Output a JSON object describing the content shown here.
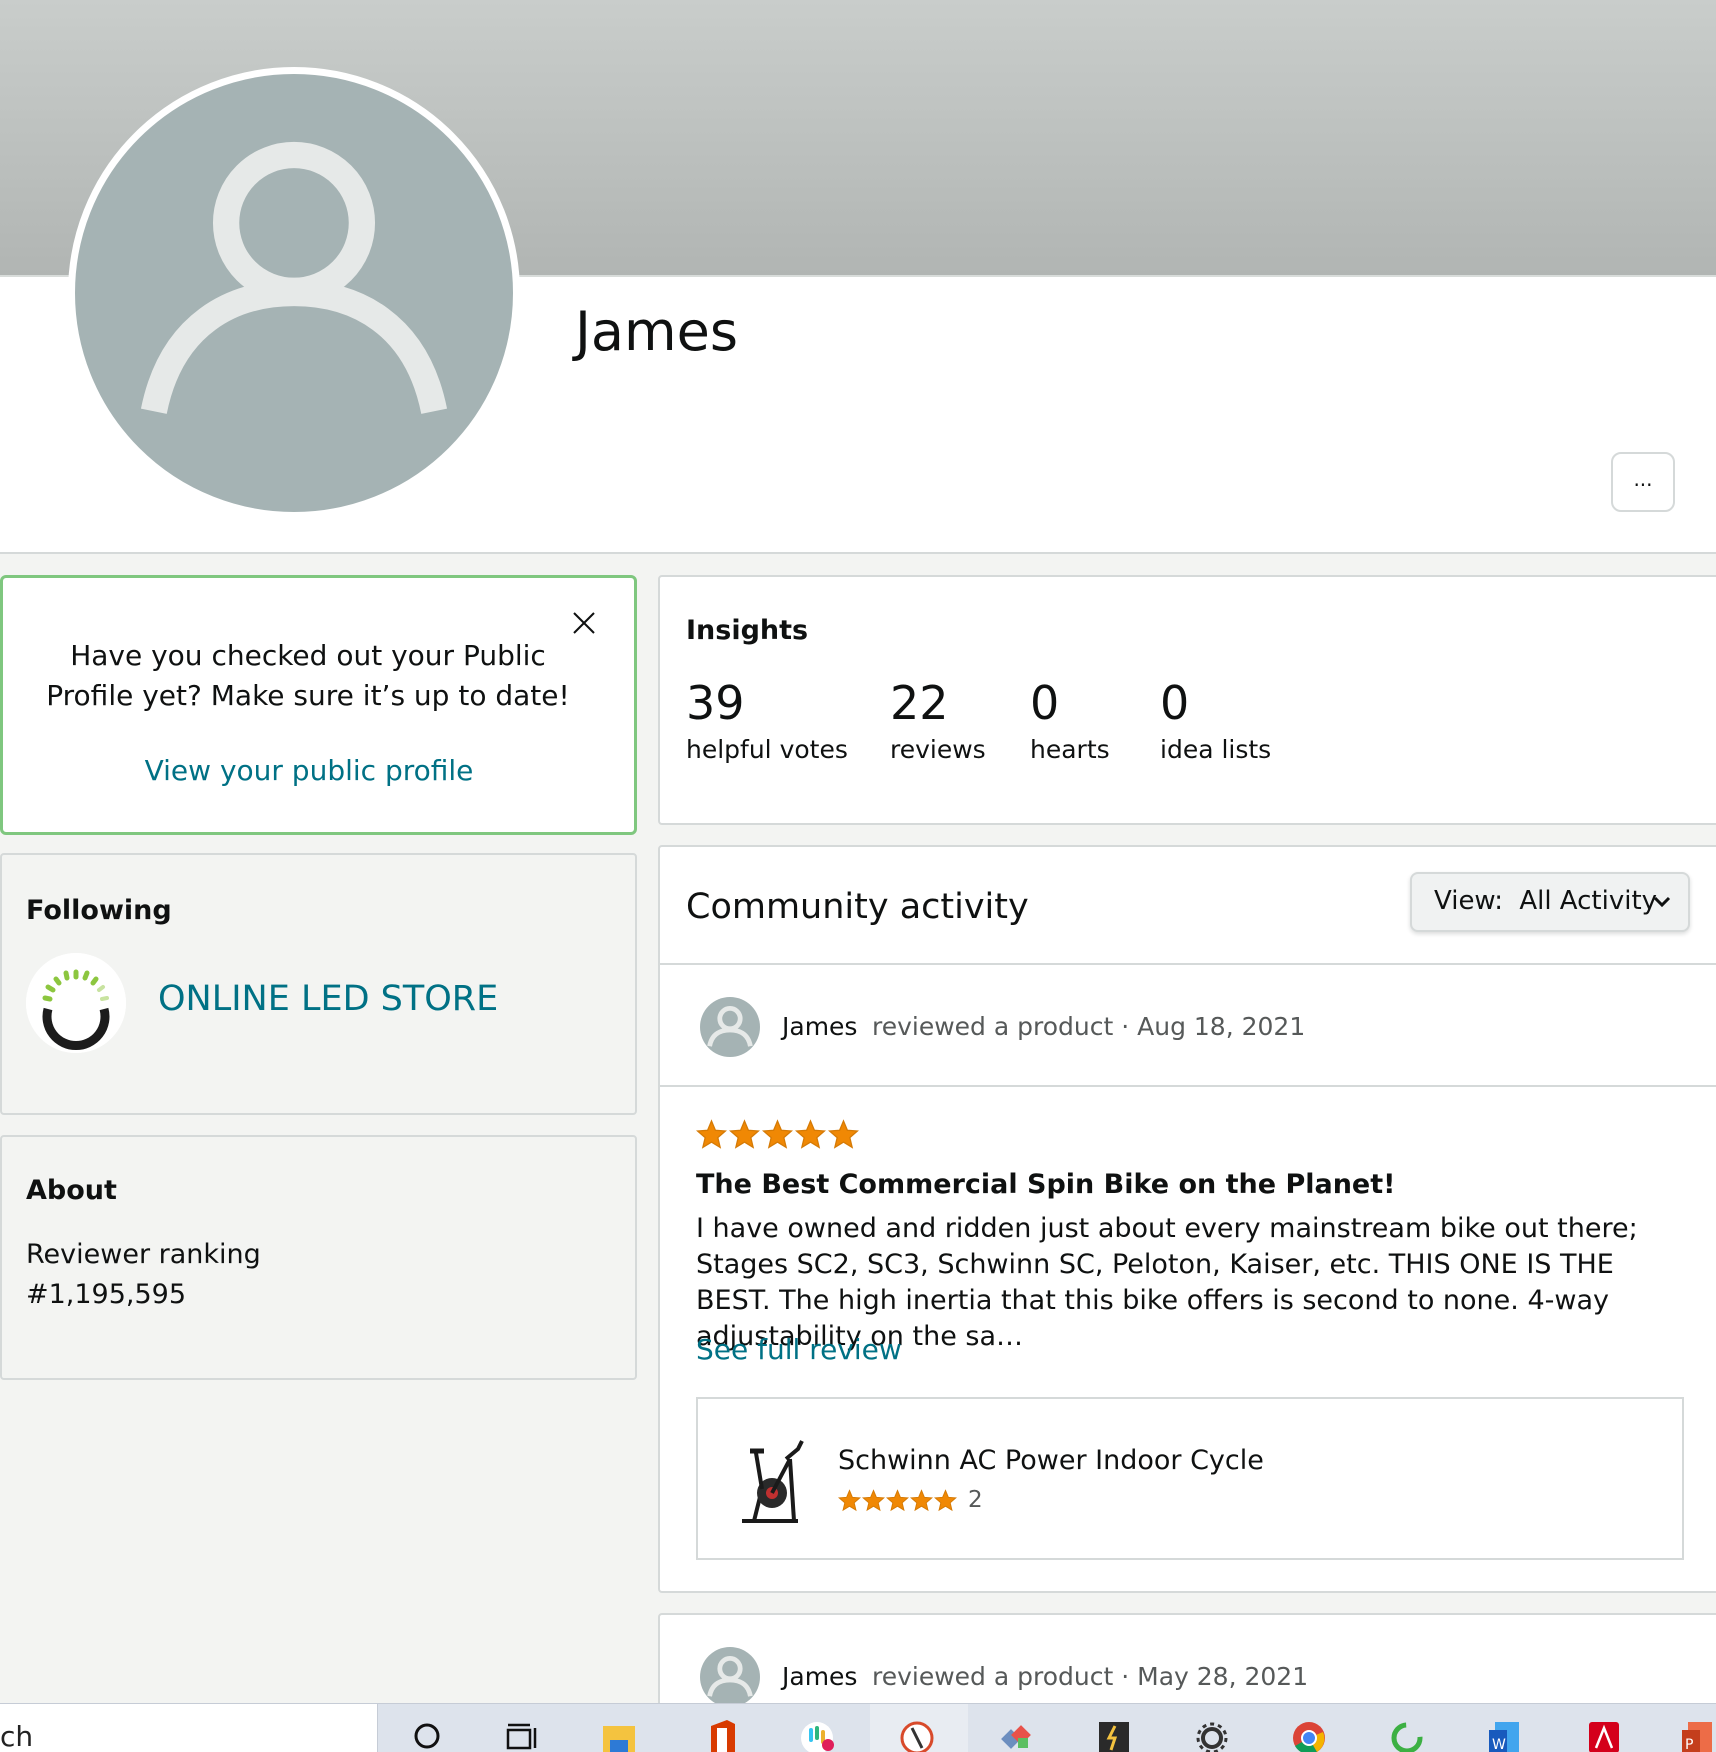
{
  "profile": {
    "name": "James",
    "more_label": "..."
  },
  "promo": {
    "text": "Have you checked out your Public Profile yet? Make sure it’s up to date!",
    "link": "View your public profile"
  },
  "following": {
    "title": "Following",
    "items": [
      {
        "name": "ONLINE LED STORE"
      }
    ]
  },
  "about": {
    "title": "About",
    "ranking_label": "Reviewer ranking",
    "ranking_value": "#1,195,595"
  },
  "insights": {
    "title": "Insights",
    "stats": [
      {
        "value": "39",
        "label": "helpful votes"
      },
      {
        "value": "22",
        "label": "reviews"
      },
      {
        "value": "0",
        "label": "hearts"
      },
      {
        "value": "0",
        "label": "idea lists"
      }
    ]
  },
  "community": {
    "title": "Community activity",
    "view_label": "View:",
    "view_value": "All Activity",
    "activities": [
      {
        "user": "James",
        "meta": "reviewed a product · Aug 18, 2021",
        "rating": 5,
        "review_title": "The Best Commercial Spin Bike on the Planet!",
        "review_body": "I have owned and ridden just about every mainstream bike out there; Stages SC2, SC3, Schwinn SC, Peloton, Kaiser, etc. THIS ONE IS THE BEST. The high inertia that this bike offers is second to none. 4-way adjustability on the sa…",
        "see_full": "See full review",
        "product": {
          "name": "Schwinn AC Power Indoor Cycle",
          "rating": 5,
          "rating_count": "2"
        }
      },
      {
        "user": "James",
        "meta": "reviewed a product · May 28, 2021"
      }
    ]
  },
  "taskbar": {
    "search_text": "ch",
    "icons": [
      "search-icon",
      "task-view-icon",
      "file-explorer-icon",
      "office-icon",
      "slack-icon",
      "app-icon",
      "app-icon-2",
      "app-icon-3",
      "settings-icon",
      "chrome-icon",
      "app-icon-4",
      "word-icon",
      "acrobat-icon",
      "powerpoint-icon"
    ]
  },
  "colors": {
    "link": "#007185",
    "star": "#f08804",
    "promo_border": "#7fc77f",
    "avatar_bg": "#a5b3b4"
  }
}
